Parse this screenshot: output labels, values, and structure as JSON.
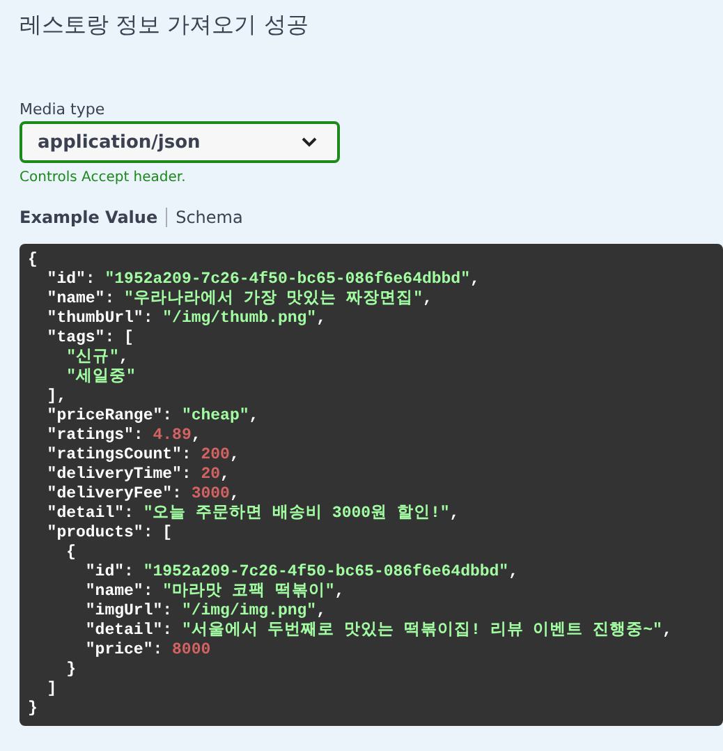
{
  "response": {
    "description": "레스토랑 정보 가져오기 성공"
  },
  "media_type": {
    "label": "Media type",
    "value": "application/json",
    "hint": "Controls Accept header."
  },
  "tabs": [
    {
      "label": "Example Value",
      "selected": true
    },
    {
      "label": "Schema",
      "selected": false
    }
  ],
  "example": {
    "lines": [
      [
        {
          "kind": "punct",
          "text": "{"
        }
      ],
      [
        {
          "kind": "key",
          "text": "  \"id\""
        },
        {
          "kind": "punct",
          "text": ": "
        },
        {
          "kind": "string",
          "text": "\"1952a209-7c26-4f50-bc65-086f6e64dbbd\""
        },
        {
          "kind": "punct",
          "text": ","
        }
      ],
      [
        {
          "kind": "key",
          "text": "  \"name\""
        },
        {
          "kind": "punct",
          "text": ": "
        },
        {
          "kind": "string",
          "text": "\"우라나라에서 가장 맛있는 짜장면집\""
        },
        {
          "kind": "punct",
          "text": ","
        }
      ],
      [
        {
          "kind": "key",
          "text": "  \"thumbUrl\""
        },
        {
          "kind": "punct",
          "text": ": "
        },
        {
          "kind": "string",
          "text": "\"/img/thumb.png\""
        },
        {
          "kind": "punct",
          "text": ","
        }
      ],
      [
        {
          "kind": "key",
          "text": "  \"tags\""
        },
        {
          "kind": "punct",
          "text": ": ["
        }
      ],
      [
        {
          "kind": "string",
          "text": "    \"신규\""
        },
        {
          "kind": "punct",
          "text": ","
        }
      ],
      [
        {
          "kind": "string",
          "text": "    \"세일중\""
        }
      ],
      [
        {
          "kind": "punct",
          "text": "  ],"
        }
      ],
      [
        {
          "kind": "key",
          "text": "  \"priceRange\""
        },
        {
          "kind": "punct",
          "text": ": "
        },
        {
          "kind": "string",
          "text": "\"cheap\""
        },
        {
          "kind": "punct",
          "text": ","
        }
      ],
      [
        {
          "kind": "key",
          "text": "  \"ratings\""
        },
        {
          "kind": "punct",
          "text": ": "
        },
        {
          "kind": "number",
          "text": "4.89"
        },
        {
          "kind": "punct",
          "text": ","
        }
      ],
      [
        {
          "kind": "key",
          "text": "  \"ratingsCount\""
        },
        {
          "kind": "punct",
          "text": ": "
        },
        {
          "kind": "number",
          "text": "200"
        },
        {
          "kind": "punct",
          "text": ","
        }
      ],
      [
        {
          "kind": "key",
          "text": "  \"deliveryTime\""
        },
        {
          "kind": "punct",
          "text": ": "
        },
        {
          "kind": "number",
          "text": "20"
        },
        {
          "kind": "punct",
          "text": ","
        }
      ],
      [
        {
          "kind": "key",
          "text": "  \"deliveryFee\""
        },
        {
          "kind": "punct",
          "text": ": "
        },
        {
          "kind": "number",
          "text": "3000"
        },
        {
          "kind": "punct",
          "text": ","
        }
      ],
      [
        {
          "kind": "key",
          "text": "  \"detail\""
        },
        {
          "kind": "punct",
          "text": ": "
        },
        {
          "kind": "string",
          "text": "\"오늘 주문하면 배송비 3000원 할인!\""
        },
        {
          "kind": "punct",
          "text": ","
        }
      ],
      [
        {
          "kind": "key",
          "text": "  \"products\""
        },
        {
          "kind": "punct",
          "text": ": ["
        }
      ],
      [
        {
          "kind": "punct",
          "text": "    {"
        }
      ],
      [
        {
          "kind": "key",
          "text": "      \"id\""
        },
        {
          "kind": "punct",
          "text": ": "
        },
        {
          "kind": "string",
          "text": "\"1952a209-7c26-4f50-bc65-086f6e64dbbd\""
        },
        {
          "kind": "punct",
          "text": ","
        }
      ],
      [
        {
          "kind": "key",
          "text": "      \"name\""
        },
        {
          "kind": "punct",
          "text": ": "
        },
        {
          "kind": "string",
          "text": "\"마라맛 코팩 떡볶이\""
        },
        {
          "kind": "punct",
          "text": ","
        }
      ],
      [
        {
          "kind": "key",
          "text": "      \"imgUrl\""
        },
        {
          "kind": "punct",
          "text": ": "
        },
        {
          "kind": "string",
          "text": "\"/img/img.png\""
        },
        {
          "kind": "punct",
          "text": ","
        }
      ],
      [
        {
          "kind": "key",
          "text": "      \"detail\""
        },
        {
          "kind": "punct",
          "text": ": "
        },
        {
          "kind": "string",
          "text": "\"서울에서 두번째로 맛있는 떡볶이집! 리뷰 이벤트 진행중~\""
        },
        {
          "kind": "punct",
          "text": ","
        }
      ],
      [
        {
          "kind": "key",
          "text": "      \"price\""
        },
        {
          "kind": "punct",
          "text": ": "
        },
        {
          "kind": "number",
          "text": "8000"
        }
      ],
      [
        {
          "kind": "punct",
          "text": "    }"
        }
      ],
      [
        {
          "kind": "punct",
          "text": "  ]"
        }
      ],
      [
        {
          "kind": "punct",
          "text": "}"
        }
      ]
    ]
  }
}
